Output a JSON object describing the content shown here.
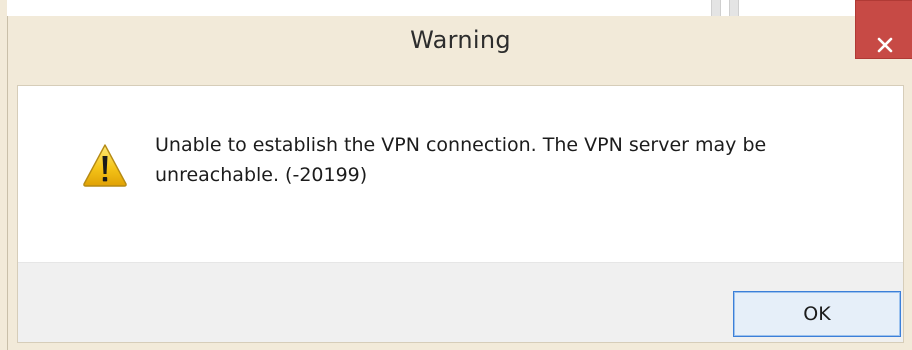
{
  "dialog": {
    "title": "Warning",
    "message": "Unable to establish the VPN connection. The VPN server may be unreachable. (-20199)",
    "ok_label": "OK",
    "close_glyph": "✕",
    "icons": {
      "close": "close-icon",
      "warning": "warning-icon"
    },
    "colors": {
      "frame": "#f2ead9",
      "close_button": "#c74a45",
      "button_border": "#3c7fd8",
      "warning_yellow": "#f5c518"
    }
  }
}
